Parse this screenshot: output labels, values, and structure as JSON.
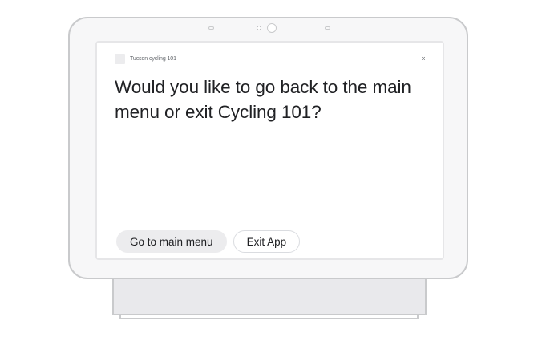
{
  "app": {
    "name": "Tucson cycling 101",
    "close_symbol": "×"
  },
  "prompt": {
    "text": "Would you like to go back to the main menu or exit Cycling 101?"
  },
  "suggestions": [
    {
      "label": "Go to main menu",
      "style": "filled"
    },
    {
      "label": "Exit App",
      "style": "outlined"
    }
  ],
  "colors": {
    "frame_border": "#c9cacc",
    "chip_fill": "#ececee",
    "text_primary": "#202124",
    "text_secondary": "#5f6368"
  }
}
